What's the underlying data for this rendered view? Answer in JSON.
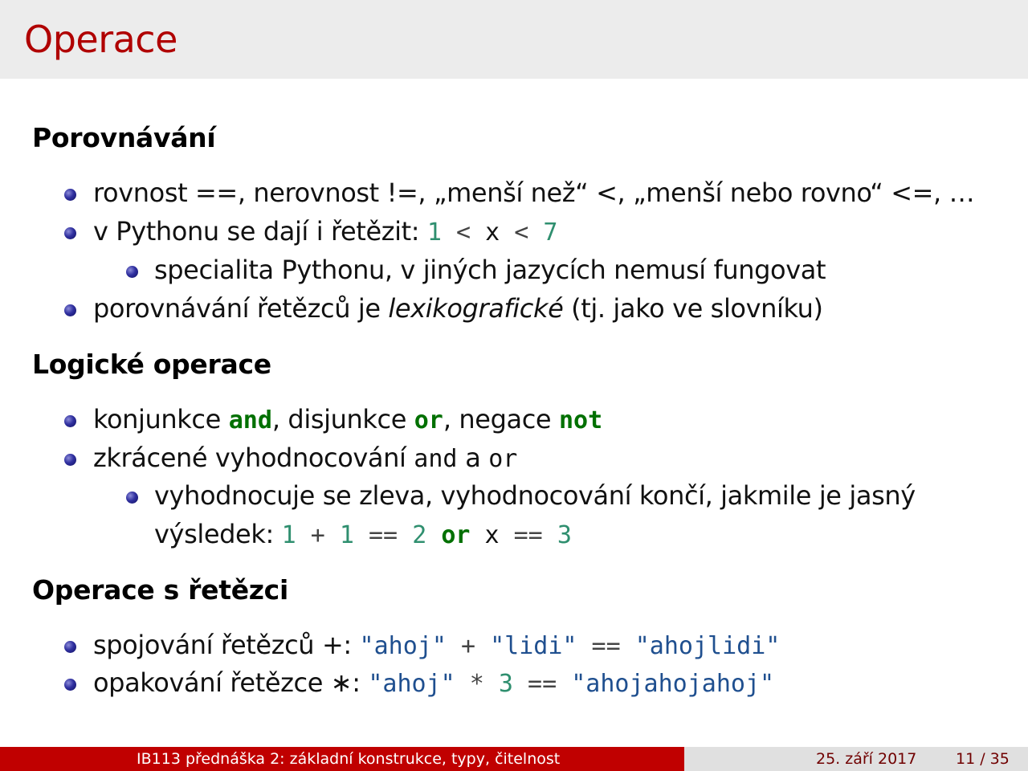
{
  "slide": {
    "title": "Operace"
  },
  "sections": [
    {
      "heading": "Porovnávání",
      "items": [
        {
          "text": "rovnost ==, nerovnost !=, „menší než“ <, „menší nebo rovno“ <=, …"
        },
        {
          "text_prefix": "v Pythonu se dají i řetězit: ",
          "code": [
            "1",
            "<",
            "x",
            "<",
            "7"
          ]
        },
        {
          "text": "specialita Pythonu, v jiných jazycích nemusí fungovat"
        },
        {
          "text_prefix": "porovnávání řetězců je ",
          "italic": "lexikografické",
          "text_suffix": " (tj. jako ve slovníku)"
        }
      ]
    },
    {
      "heading": "Logické operace",
      "items": [
        {
          "parts": [
            "konjunkce ",
            "and",
            ", disjunkce ",
            "or",
            ", negace ",
            "not"
          ]
        },
        {
          "parts": [
            "zkrácené vyhodnocování ",
            "and",
            " a ",
            "or"
          ]
        },
        {
          "line1": "vyhodnocuje se zleva, vyhodnocování končí, jakmile je jasný",
          "line2_prefix": "výsledek: ",
          "code": [
            "1",
            "+",
            "1",
            "==",
            "2",
            "or",
            "x",
            "==",
            "3"
          ]
        }
      ]
    },
    {
      "heading": "Operace s řetězci",
      "items": [
        {
          "text_prefix": "spojování řetězců +: ",
          "code": [
            "\"ahoj\"",
            "+",
            "\"lidi\"",
            "==",
            "\"ahojlidi\""
          ]
        },
        {
          "text_prefix": "opakování řetězce ∗: ",
          "code": [
            "\"ahoj\"",
            "*",
            "3",
            "==",
            "\"ahojahojahoj\""
          ]
        }
      ]
    }
  ],
  "footer": {
    "lecture": "IB113 přednáška 2: základní konstrukce, typy, čitelnost",
    "date": "25. září 2017",
    "page": "11 / 35"
  },
  "colors": {
    "title": "#b00000",
    "footer_left_bg": "#c00000",
    "number": "#2f8f6f",
    "keyword": "#007000",
    "string": "#1f4f8f"
  }
}
